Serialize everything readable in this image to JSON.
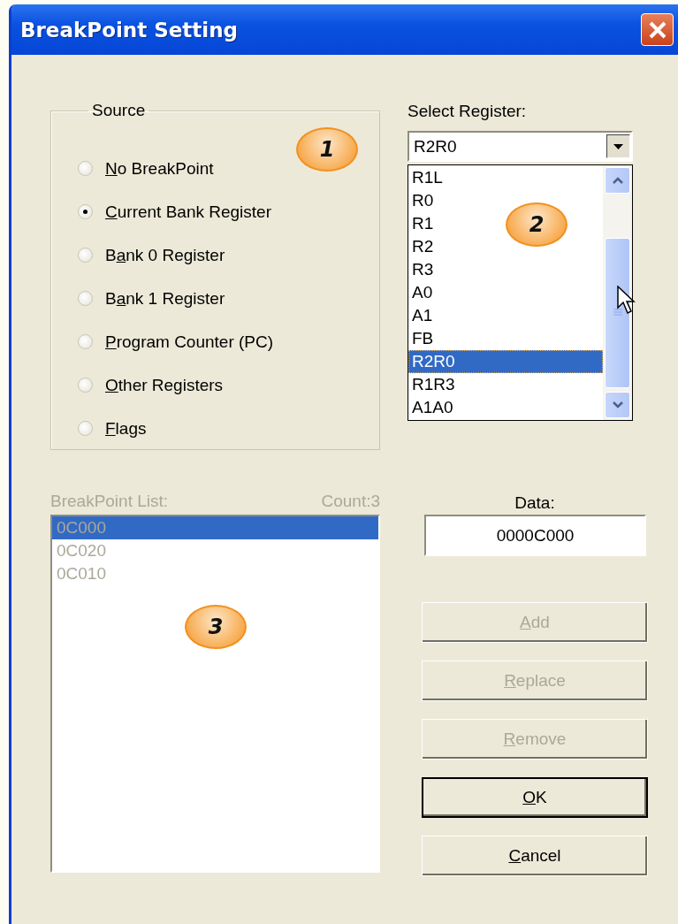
{
  "window": {
    "title": "BreakPoint Setting"
  },
  "source": {
    "legend": "Source",
    "options": [
      {
        "key": "N",
        "after": "o BreakPoint",
        "selected": false
      },
      {
        "key": "C",
        "after": "urrent Bank Register",
        "selected": true
      },
      {
        "before": "B",
        "key": "a",
        "after": "nk 0 Register",
        "selected": false
      },
      {
        "before": "B",
        "key": "a",
        "after": "nk 1 Register",
        "selected": false
      },
      {
        "key": "P",
        "after": "rogram Counter (PC)",
        "selected": false
      },
      {
        "key": "O",
        "after": "ther Registers",
        "selected": false
      },
      {
        "key": "F",
        "after": "lags",
        "selected": false
      }
    ]
  },
  "register": {
    "label": "Select Register:",
    "value": "R2R0",
    "expanded": true,
    "options": [
      {
        "label": "R1L",
        "selected": false
      },
      {
        "label": "R0",
        "selected": false
      },
      {
        "label": "R1",
        "selected": false
      },
      {
        "label": "R2",
        "selected": false
      },
      {
        "label": "R3",
        "selected": false
      },
      {
        "label": "A0",
        "selected": false
      },
      {
        "label": "A1",
        "selected": false
      },
      {
        "label": "FB",
        "selected": false
      },
      {
        "label": "R2R0",
        "selected": true
      },
      {
        "label": "R1R3",
        "selected": false
      },
      {
        "label": "A1A0",
        "selected": false
      }
    ]
  },
  "breakpoint_list": {
    "label": "BreakPoint List:",
    "count": "Count:3",
    "disabled": true,
    "items": [
      {
        "text": "0C000",
        "selected": true
      },
      {
        "text": "0C020",
        "selected": false
      },
      {
        "text": "0C010",
        "selected": false
      }
    ]
  },
  "data": {
    "label": "Data:",
    "value": "0000C000"
  },
  "buttons": [
    {
      "key": "A",
      "after": "dd",
      "disabled": true,
      "default": false
    },
    {
      "key": "R",
      "after": "eplace",
      "disabled": true,
      "default": false
    },
    {
      "key": "R",
      "after": "emove",
      "disabled": true,
      "default": false
    },
    {
      "key": "O",
      "after": "K",
      "disabled": false,
      "default": true
    },
    {
      "key": "C",
      "after": "ancel",
      "disabled": false,
      "default": false
    }
  ],
  "callouts": [
    "1",
    "2",
    "3"
  ]
}
